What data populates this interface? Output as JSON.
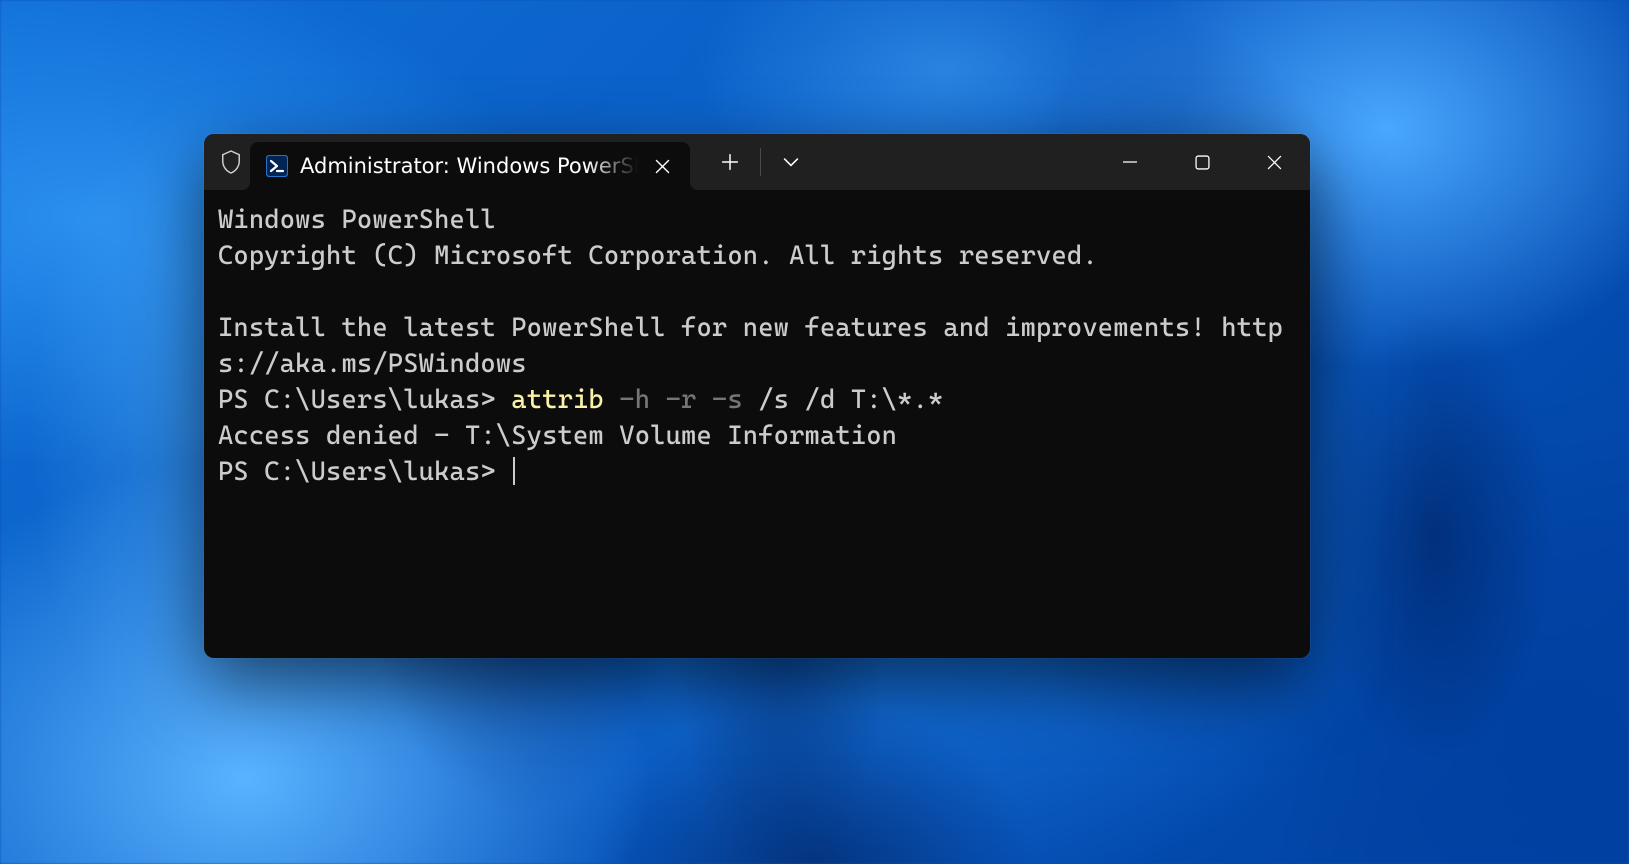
{
  "tab": {
    "title": "Administrator: Windows PowerShell"
  },
  "terminal": {
    "header1": "Windows PowerShell",
    "header2": "Copyright (C) Microsoft Corporation. All rights reserved.",
    "install_msg": "Install the latest PowerShell for new features and improvements! https://aka.ms/PSWindows",
    "prompt1_prefix": "PS C:\\Users\\lukas> ",
    "cmd_name": "attrib",
    "cmd_flags": " -h -r -s",
    "cmd_rest": " /s /d T:\\*.*",
    "error_line": "Access denied - T:\\System Volume Information",
    "prompt2": "PS C:\\Users\\lukas> "
  }
}
